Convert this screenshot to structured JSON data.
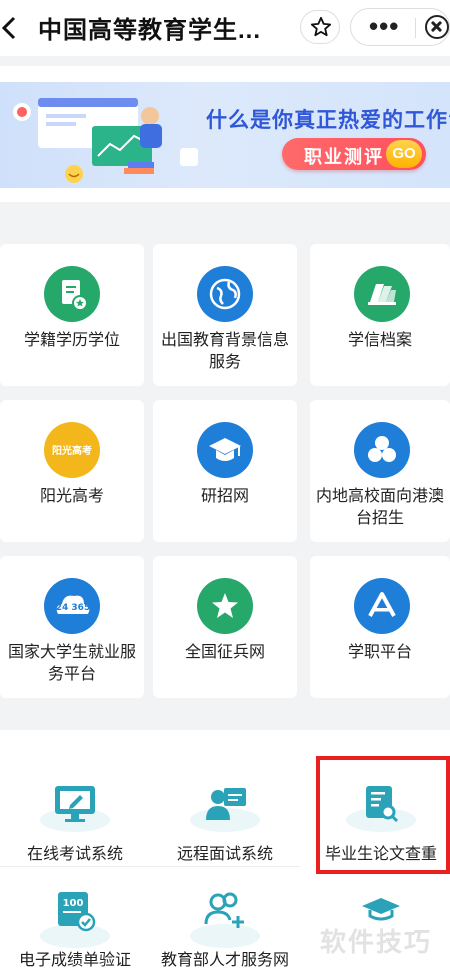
{
  "header": {
    "title": "中国高等教育学生...",
    "more_label": "•••"
  },
  "banner": {
    "question": "什么是你真正热爱的工作?",
    "button_label": "职业测评",
    "go_label": "GO"
  },
  "grid": {
    "items": [
      {
        "label": "学籍学历学位",
        "icon": "document-star-icon",
        "color": "#27a86b"
      },
      {
        "label": "出国教育背景信息服务",
        "icon": "globe-icon",
        "color": "#1f7ed8"
      },
      {
        "label": "学信档案",
        "icon": "files-icon",
        "color": "#27a86b"
      },
      {
        "label": "阳光高考",
        "icon": "sunshine-gaokao-icon",
        "color": "#f3b71b"
      },
      {
        "label": "研招网",
        "icon": "graduation-cap-icon",
        "color": "#1f7ed8"
      },
      {
        "label": "内地高校面向港澳台招生",
        "icon": "flower-icon",
        "color": "#1f7ed8"
      },
      {
        "label": "国家大学生就业服务平台",
        "icon": "cloud-24365-icon",
        "color": "#1f7ed8"
      },
      {
        "label": "全国征兵网",
        "icon": "star-icon",
        "color": "#27a86b"
      },
      {
        "label": "学职平台",
        "icon": "a-triangle-icon",
        "color": "#1f7ed8"
      }
    ],
    "cloud_badge": "24 365",
    "sunshine_badge": "阳光高考"
  },
  "services": {
    "items": [
      {
        "label": "在线考试系统",
        "icon": "monitor-edit-icon"
      },
      {
        "label": "远程面试系统",
        "icon": "video-interview-icon"
      },
      {
        "label": "毕业生论文查重",
        "icon": "document-search-icon"
      },
      {
        "label": "电子成绩单验证",
        "icon": "score-certificate-icon"
      },
      {
        "label": "教育部人才服务网",
        "icon": "users-add-icon"
      },
      {
        "label": "",
        "icon": "graduation-cap-outline-icon"
      }
    ],
    "score_badge": "100"
  },
  "watermark": "软件技巧",
  "colors": {
    "accent_blue": "#1f7ed8",
    "accent_green": "#27a86b",
    "highlight_red": "#e8201f",
    "cta_red": "#ff5a5f"
  }
}
